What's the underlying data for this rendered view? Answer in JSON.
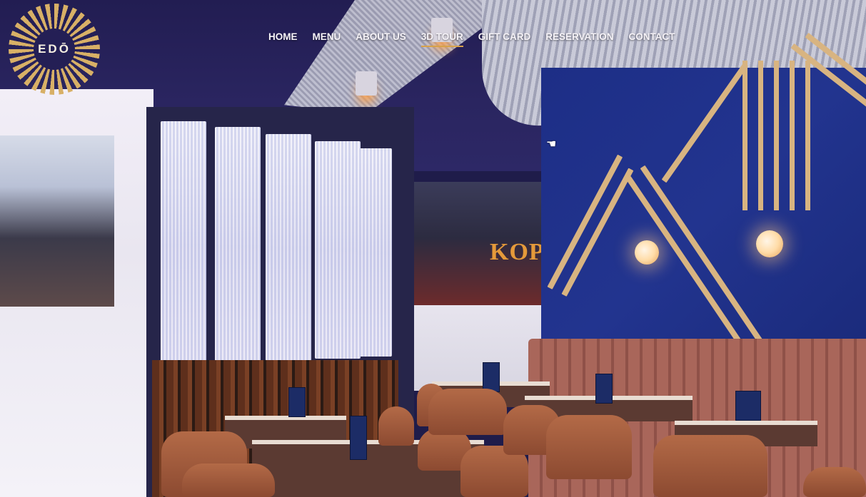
{
  "brand": {
    "logo_text": "EDŌ"
  },
  "nav": {
    "items": [
      {
        "label": "HOME"
      },
      {
        "label": "MENU"
      },
      {
        "label": "ABOUT US"
      },
      {
        "label": "3D TOUR",
        "active": true
      },
      {
        "label": "GIFT CARD"
      },
      {
        "label": "RESERVATION"
      },
      {
        "label": "CONTACT"
      }
    ]
  },
  "scene": {
    "shop_sign": "KOPPA",
    "cursor": "hand-pointer-icon"
  },
  "colors": {
    "accent": "#d8a24a",
    "wall_blue": "#22348f",
    "ceiling": "#221d52",
    "stripe_gold": "#d8b481"
  }
}
